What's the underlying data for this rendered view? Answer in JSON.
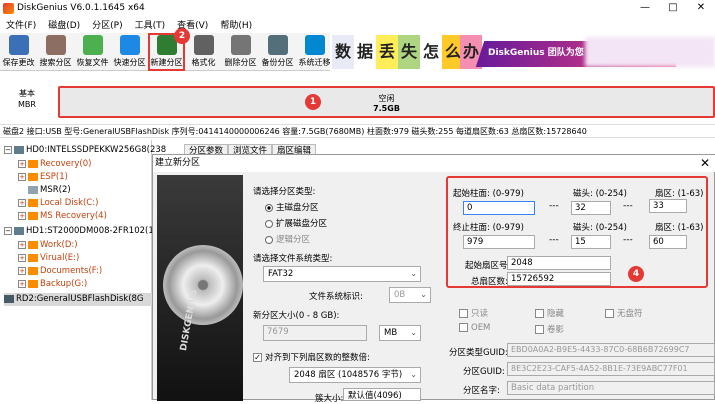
{
  "window": {
    "title": "DiskGenius V6.0.1.1645 x64",
    "controls": [
      "—",
      "□",
      "✕"
    ]
  },
  "menu": [
    "文件(F)",
    "磁盘(D)",
    "分区(P)",
    "工具(T)",
    "查看(V)",
    "帮助(H)"
  ],
  "toolbar": [
    {
      "label": "保存更改",
      "icon": "save-icon",
      "color": "#3b6fb6"
    },
    {
      "label": "搜索分区",
      "icon": "search-icon",
      "color": "#8d6e63"
    },
    {
      "label": "恢复文件",
      "icon": "restore-icon",
      "color": "#4caf50"
    },
    {
      "label": "快速分区",
      "icon": "quick-partition-icon",
      "color": "#1e88e5"
    },
    {
      "label": "新建分区",
      "icon": "new-partition-icon",
      "color": "#2e7d32"
    },
    {
      "label": "格式化",
      "icon": "format-icon",
      "color": "#616161"
    },
    {
      "label": "删除分区",
      "icon": "delete-icon",
      "color": "#757575"
    },
    {
      "label": "备份分区",
      "icon": "backup-icon",
      "color": "#546e7a"
    },
    {
      "label": "系统迁移",
      "icon": "migrate-icon",
      "color": "#0288d1"
    }
  ],
  "banner": {
    "chars": [
      "数",
      "据",
      "丢",
      "失",
      "怎",
      "么",
      "办"
    ],
    "text": "DiskGenius 团队为您"
  },
  "badges": {
    "b1": "1",
    "b2": "2",
    "b4": "4"
  },
  "diskmap": {
    "basic": "基本",
    "type": "MBR",
    "free_label": "空闲",
    "free_size": "7.5GB"
  },
  "infobar": "磁盘2 接口:USB 型号:GeneralUSBFlashDisk 序列号:0414140000006246 容量:7.5GB(7680MB) 柱面数:979 磁头数:255 每道扇区数:63 总扇区数:15728640",
  "tree": [
    {
      "text": "HD0:INTELSSDPEKKW256G8(238",
      "indent": 0,
      "tog": "−",
      "cls": ""
    },
    {
      "text": "Recovery(0)",
      "indent": 1,
      "tog": "+",
      "cls": "orange"
    },
    {
      "text": "ESP(1)",
      "indent": 1,
      "tog": "+",
      "cls": "orange"
    },
    {
      "text": "MSR(2)",
      "indent": 1,
      "tog": "",
      "cls": ""
    },
    {
      "text": "Local Disk(C:)",
      "indent": 1,
      "tog": "+",
      "cls": "orange"
    },
    {
      "text": "MS Recovery(4)",
      "indent": 1,
      "tog": "+",
      "cls": "orange"
    },
    {
      "text": "HD1:ST2000DM008-2FR102(18",
      "indent": 0,
      "tog": "−",
      "cls": ""
    },
    {
      "text": "Work(D:)",
      "indent": 1,
      "tog": "+",
      "cls": "orange"
    },
    {
      "text": "Virual(E:)",
      "indent": 1,
      "tog": "+",
      "cls": "orange"
    },
    {
      "text": "Documents(F:)",
      "indent": 1,
      "tog": "+",
      "cls": "orange"
    },
    {
      "text": "Backup(G:)",
      "indent": 1,
      "tog": "+",
      "cls": "orange"
    },
    {
      "text": "RD2:GeneralUSBFlashDisk(8G",
      "indent": 0,
      "tog": "",
      "cls": "sel"
    }
  ],
  "tabs": [
    "分区参数",
    "浏览文件",
    "扇区编辑"
  ],
  "dialog": {
    "title": "建立新分区",
    "close": "✕",
    "brand": "DISKGENIUS",
    "ptype_label": "请选择分区类型:",
    "ptype_options": [
      "主磁盘分区",
      "扩展磁盘分区",
      "逻辑分区"
    ],
    "fs_label": "请选择文件系统类型:",
    "fs_value": "FAT32",
    "fs_id_label": "文件系统标识:",
    "fs_id_value": "0B",
    "size_label": "新分区大小(0 - 8 GB):",
    "size_value": "7679",
    "size_unit": "MB",
    "align_label": "对齐到下列扇区数的整数倍:",
    "align_value": "2048 扇区 (1048576 字节)",
    "cluster_label": "簇大小:",
    "cluster_value": "默认值(4096)",
    "start_cyl_label": "起始柱面: (0-979)",
    "start_cyl": "0",
    "head_label": "磁头: (0-254)",
    "start_head": "32",
    "sector_label": "扇区: (1-63)",
    "start_sector": "33",
    "end_cyl_label": "终止柱面: (0-979)",
    "end_cyl": "979",
    "end_head": "15",
    "end_sector": "60",
    "start_lba_label": "起始扇区号:",
    "start_lba": "2048",
    "total_lba_label": "总扇区数:",
    "total_lba": "15726592",
    "dash": "---",
    "attrs": [
      "只读",
      "隐藏",
      "无盘符",
      "OEM",
      "卷影"
    ],
    "guid_type_label": "分区类型GUID:",
    "guid_type": "EBD0A0A2-B9E5-4433-87C0-68B6B72699C7",
    "guid_label": "分区GUID:",
    "guid": "8E3C2E23-CAF5-4A52-8B1E-73E9ABC77F01",
    "name_label": "分区名字:",
    "name": "Basic data partition"
  }
}
